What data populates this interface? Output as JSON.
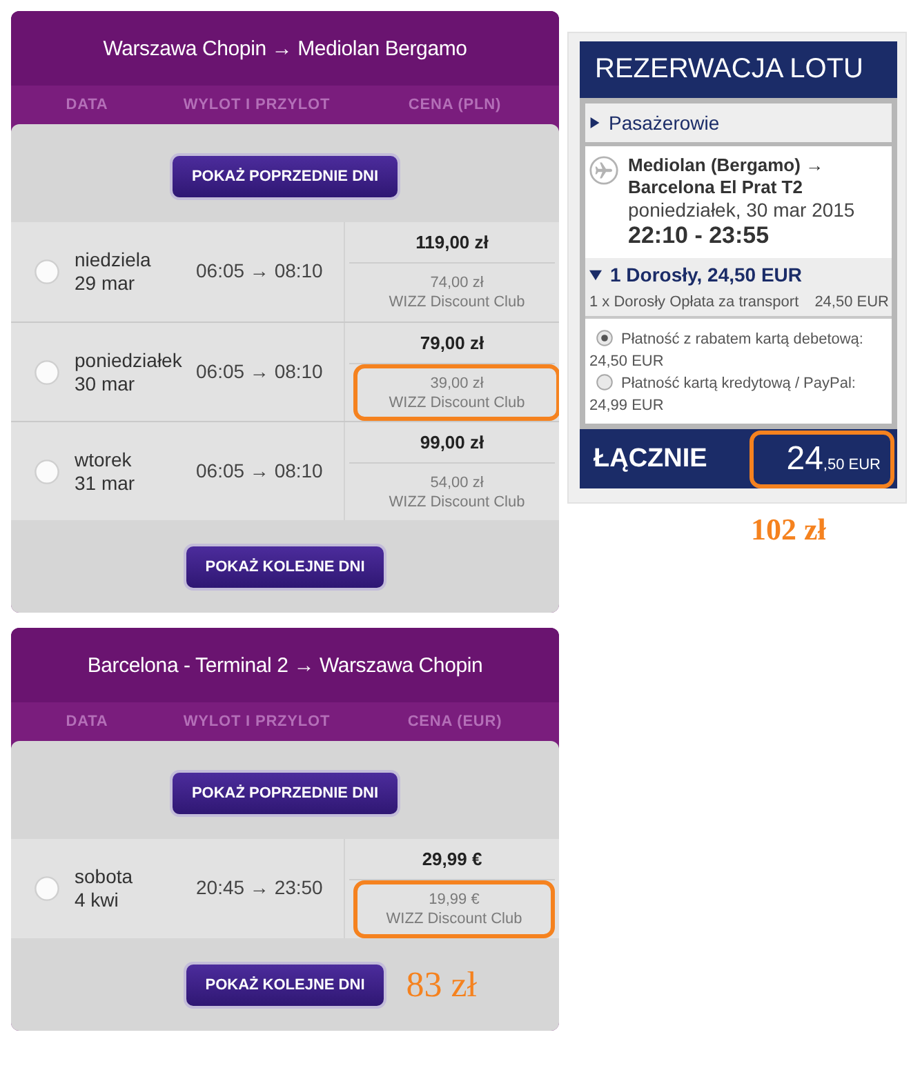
{
  "flight_panels": [
    {
      "title": "Warszawa Chopin → Mediolan Bergamo",
      "columns": [
        "DATA",
        "WYLOT I PRZYLOT",
        "CENA (PLN)"
      ],
      "prev_button": "POKAŻ POPRZEDNIE DNI",
      "rows": [
        {
          "day": "niedziela",
          "date": "29 mar",
          "times": "06:05 → 08:10",
          "price": "119,00 zł",
          "club_price": "74,00 zł",
          "club_label": "WIZZ Discount Club",
          "selected": false,
          "highlighted": false
        },
        {
          "day": "poniedziałek",
          "date": "30 mar",
          "times": "06:05 → 08:10",
          "price": "79,00 zł",
          "club_price": "39,00 zł",
          "club_label": "WIZZ Discount Club",
          "selected": false,
          "highlighted": true
        },
        {
          "day": "wtorek",
          "date": "31 mar",
          "times": "06:05 → 08:10",
          "price": "99,00 zł",
          "club_price": "54,00 zł",
          "club_label": "WIZZ Discount Club",
          "selected": false,
          "highlighted": false
        }
      ],
      "next_button": "POKAŻ KOLEJNE DNI"
    },
    {
      "title": "Barcelona - Terminal 2 → Warszawa Chopin",
      "columns": [
        "DATA",
        "WYLOT I PRZYLOT",
        "CENA (EUR)"
      ],
      "prev_button": "POKAŻ POPRZEDNIE DNI",
      "rows": [
        {
          "day": "sobota",
          "date": "4 kwi",
          "times": "20:45 → 23:50",
          "price": "29,99 €",
          "club_price": "19,99 €",
          "club_label": "WIZZ Discount Club",
          "selected": false,
          "highlighted": true
        }
      ],
      "next_button": "POKAŻ KOLEJNE DNI",
      "annotation": "83 zł"
    }
  ],
  "booking": {
    "title": "REZERWACJA LOTU",
    "passengers": {
      "label": "Pasażerowie",
      "expanded": false
    },
    "flight": {
      "route": "Mediolan (Bergamo) → Barcelona El Prat T2",
      "date": "poniedziałek, 30 mar 2015",
      "times": "22:10 - 23:55"
    },
    "fare": {
      "summary": "1 Dorosły, 24,50 EUR",
      "expanded": true,
      "item_label": "1 x Dorosły Opłata za transport",
      "item_amount": "24,50 EUR"
    },
    "payment_options": [
      {
        "label": "Płatność z rabatem kartą debetową:",
        "amount": "24,50 EUR",
        "selected": true
      },
      {
        "label": "Płatność kartą kredytową / PayPal:",
        "amount": "24,99 EUR",
        "selected": false
      }
    ],
    "total": {
      "label": "ŁĄCZNIE",
      "amount_main": "24",
      "amount_fraction": ",50 EUR",
      "highlighted": true
    },
    "annotation": "102 zł"
  }
}
